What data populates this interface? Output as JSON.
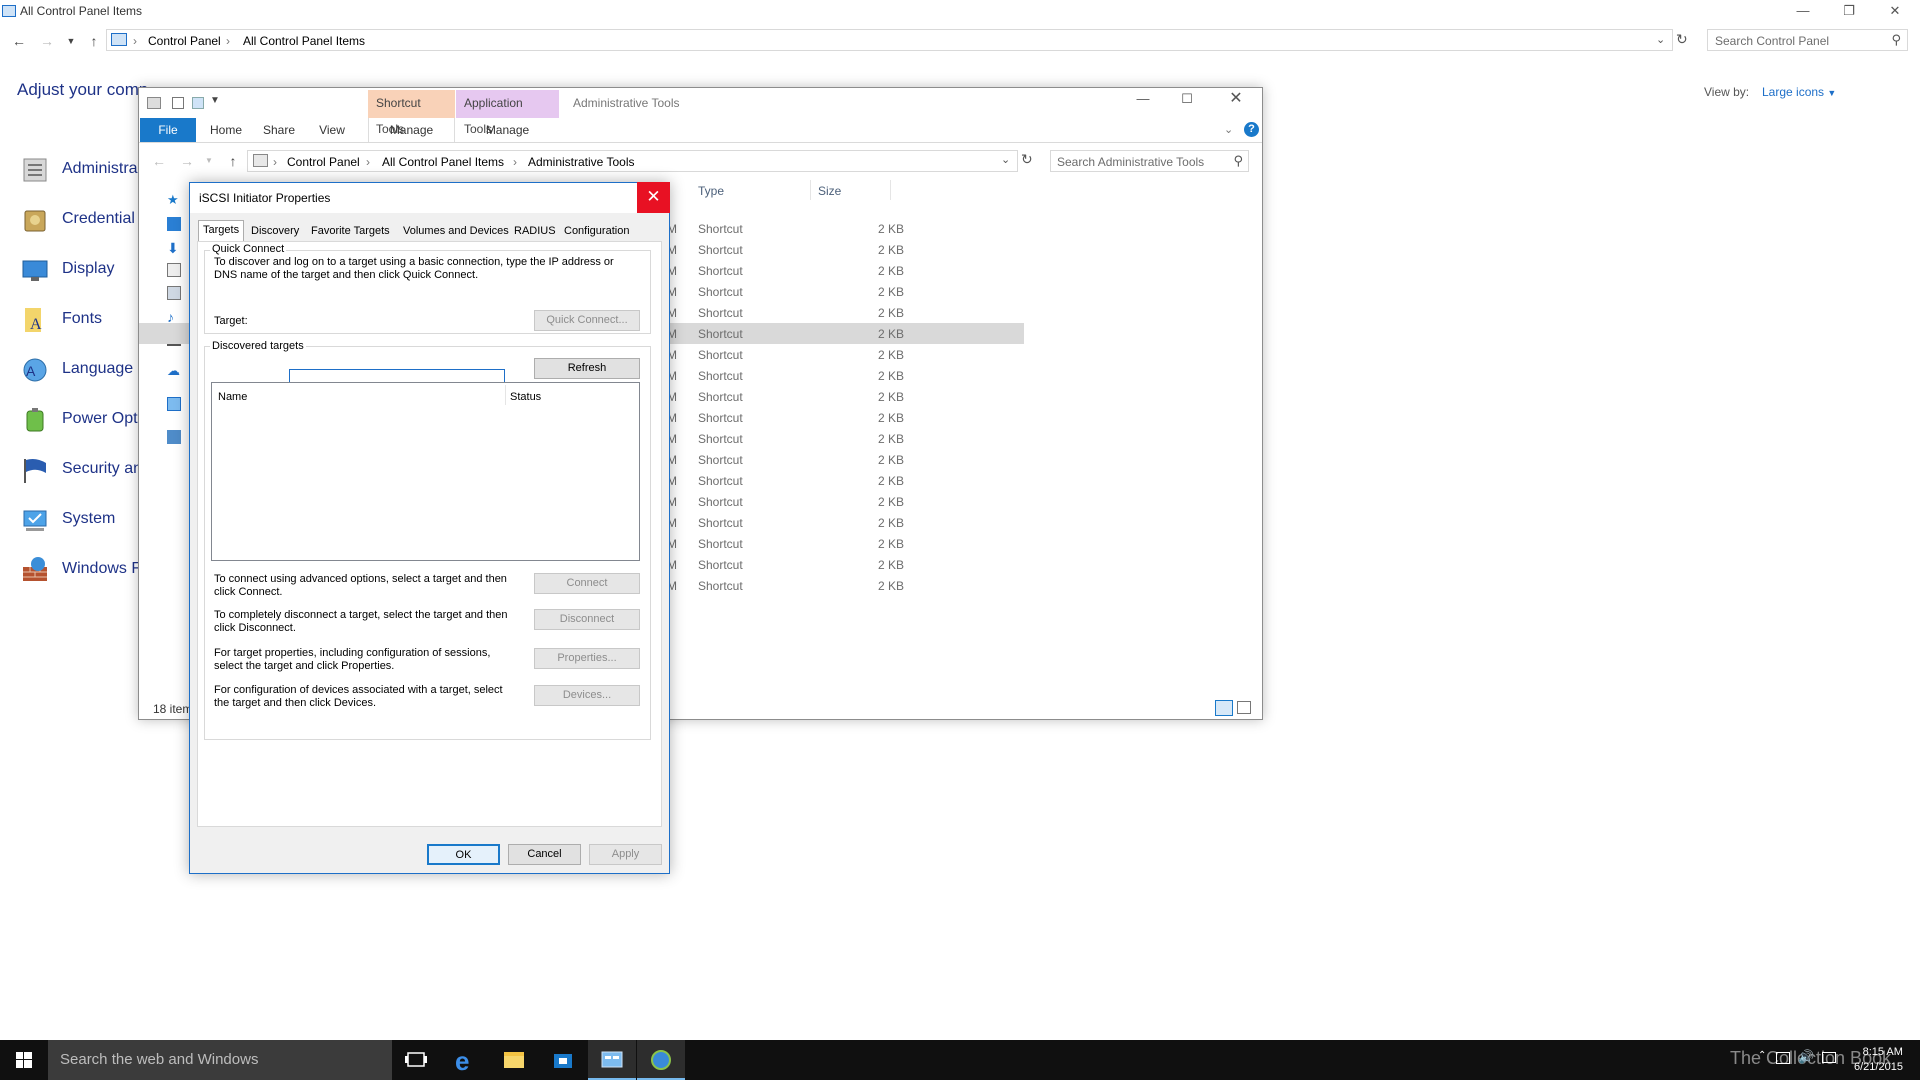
{
  "control_panel": {
    "title": "All Control Panel Items",
    "breadcrumb": [
      "Control Panel",
      "All Control Panel Items"
    ],
    "search_placeholder": "Search Control Panel",
    "heading": "Adjust your comp",
    "view_by_label": "View by:",
    "view_by_value": "Large icons",
    "items": [
      {
        "label": "Administra",
        "icon": "administrative-tools-icon"
      },
      {
        "label": "Credential",
        "icon": "credential-manager-icon"
      },
      {
        "label": "Display",
        "icon": "display-icon"
      },
      {
        "label": "Fonts",
        "icon": "fonts-icon"
      },
      {
        "label": "Language",
        "icon": "language-icon"
      },
      {
        "label": "Power Opti",
        "icon": "power-options-icon"
      },
      {
        "label": "Security an",
        "icon": "security-flag-icon"
      },
      {
        "label": "System",
        "icon": "system-icon"
      },
      {
        "label": "Windows F",
        "icon": "windows-firewall-icon"
      }
    ]
  },
  "explorer": {
    "context_tabs": {
      "shortcut_tools": "Shortcut Tools",
      "application_tools": "Application Tools"
    },
    "title": "Administrative Tools",
    "ribbon_tabs": [
      "File",
      "Home",
      "Share",
      "View",
      "Manage",
      "Manage"
    ],
    "breadcrumb": [
      "Control Panel",
      "All Control Panel Items",
      "Administrative Tools"
    ],
    "search_placeholder": "Search Administrative Tools",
    "columns": {
      "type": "Type",
      "size": "Size"
    },
    "row_type": "Shortcut",
    "row_size": "2 KB",
    "row_count": 18,
    "selected_row": 5,
    "row_prefix": "M",
    "status": "18 item"
  },
  "dialog": {
    "title": "iSCSI Initiator Properties",
    "tabs": [
      "Targets",
      "Discovery",
      "Favorite Targets",
      "Volumes and Devices",
      "RADIUS",
      "Configuration"
    ],
    "quick_connect": {
      "group_label": "Quick Connect",
      "desc": "To discover and log on to a target using a basic connection, type the IP address or DNS name of the target and then click Quick Connect.",
      "target_label": "Target:",
      "target_value": "",
      "button": "Quick Connect..."
    },
    "discovered": {
      "group_label": "Discovered targets",
      "refresh": "Refresh",
      "col_name": "Name",
      "col_status": "Status"
    },
    "actions": [
      {
        "desc": "To connect using advanced options, select a target and then click Connect.",
        "button": "Connect"
      },
      {
        "desc": "To completely disconnect a target, select the target and then click Disconnect.",
        "button": "Disconnect"
      },
      {
        "desc": "For target properties, including configuration of sessions, select the target and click Properties.",
        "button": "Properties..."
      },
      {
        "desc": "For configuration of devices associated with a target, select the target and then click Devices.",
        "button": "Devices..."
      }
    ],
    "ok": "OK",
    "cancel": "Cancel",
    "apply": "Apply"
  },
  "taskbar": {
    "search_placeholder": "Search the web and Windows",
    "time": "8:15 AM",
    "date": "6/21/2015",
    "watermark": "The Collection Book"
  },
  "colors": {
    "accent": "#1979ca",
    "close_red": "#e81123",
    "shortcut_tools": "#f9d2b8",
    "application_tools": "#e6c8f0"
  }
}
